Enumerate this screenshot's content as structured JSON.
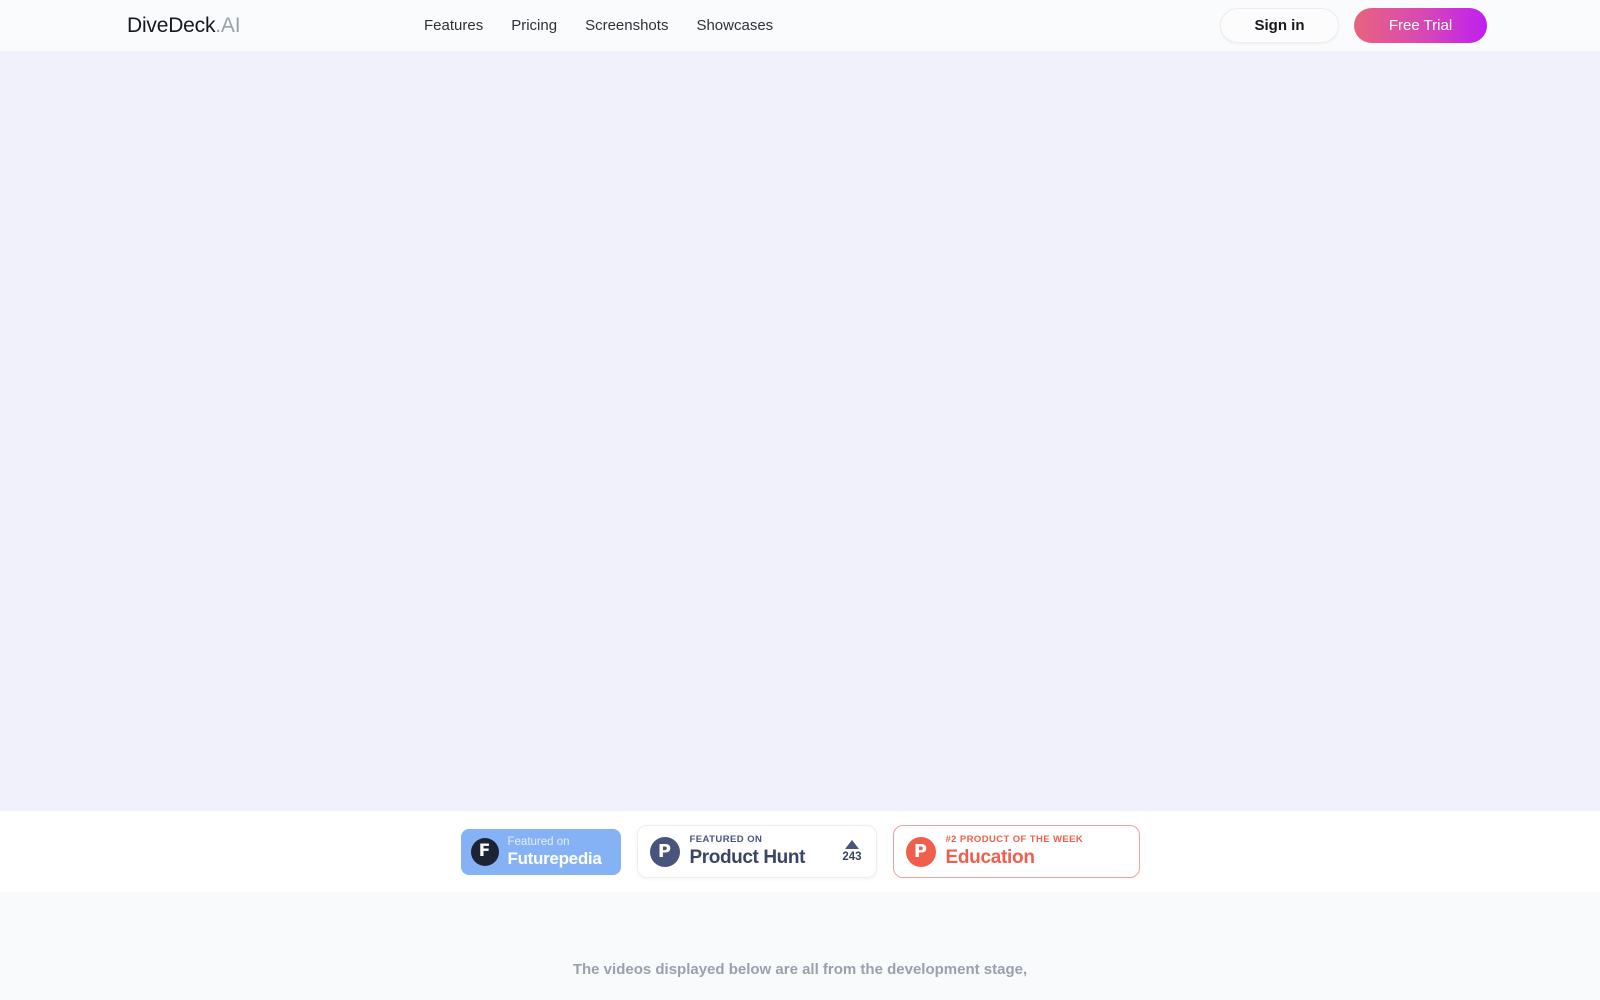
{
  "header": {
    "brand": {
      "main": "DiveDeck",
      "suffix": ".AI"
    },
    "nav": [
      {
        "label": "Features"
      },
      {
        "label": "Pricing"
      },
      {
        "label": "Screenshots"
      },
      {
        "label": "Showcases"
      }
    ],
    "signin_label": "Sign in",
    "freetrial_label": "Free Trial",
    "colors": {
      "header_bg": "#fafbfd",
      "freetrial_gradient_start": "#e8637f",
      "freetrial_gradient_end": "#c01ff0"
    }
  },
  "hero": {
    "background_color": "#f1f1fc"
  },
  "badges": {
    "futurepedia": {
      "logo_letter": "F",
      "eyebrow": "Featured on",
      "title": "Futurepedia",
      "bg_color": "#84b2f5"
    },
    "producthunt": {
      "logo_letter": "P",
      "eyebrow": "FEATURED ON",
      "title": "Product Hunt",
      "vote_count": "243",
      "accent_color": "#49547e"
    },
    "education": {
      "logo_letter": "P",
      "eyebrow": "#2 PRODUCT OF THE WEEK",
      "title": "Education",
      "accent_color": "#ef5f4c"
    }
  },
  "lower": {
    "notice": "The videos displayed below are all from the development stage,",
    "background_color": "#f9fafc"
  }
}
